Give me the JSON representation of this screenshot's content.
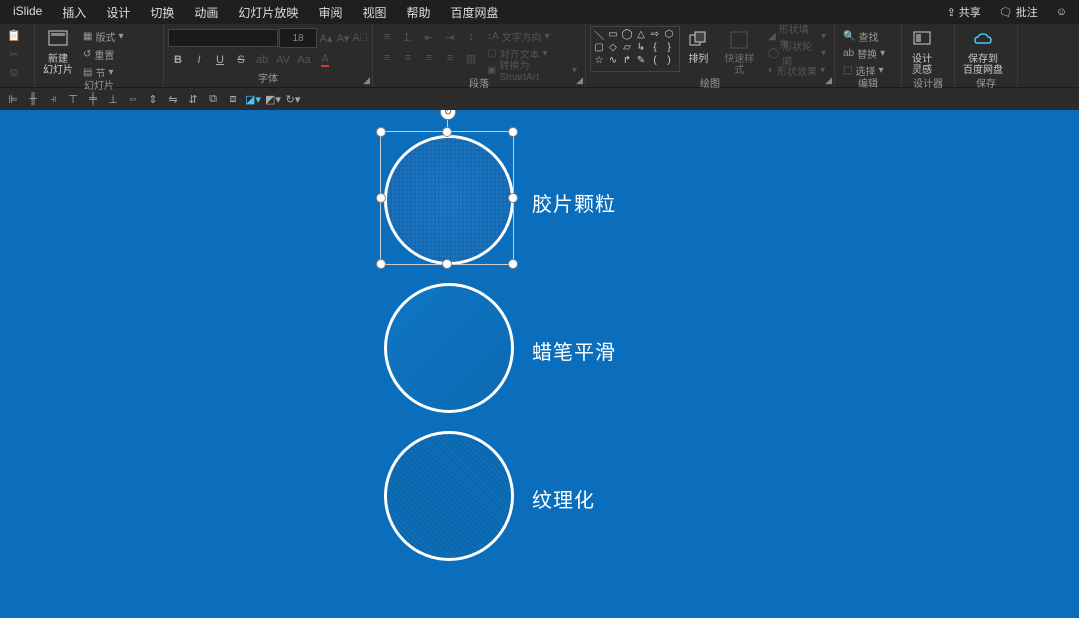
{
  "menu": {
    "tabs": [
      "iSlide",
      "插入",
      "设计",
      "切换",
      "动画",
      "幻灯片放映",
      "审阅",
      "视图",
      "帮助",
      "百度网盘"
    ],
    "share": "共享",
    "comment": "批注"
  },
  "ribbon": {
    "slide": {
      "new_slide": "新建\n幻灯片",
      "layout": "版式",
      "reset": "重置",
      "section": "节",
      "group": "幻灯片"
    },
    "font": {
      "size": "18",
      "bold": "B",
      "italic": "I",
      "underline": "U",
      "strike": "S",
      "highlight": "ab",
      "spacing": "AV",
      "clear": "A",
      "increase": "A",
      "decrease": "A",
      "group": "字体",
      "ax": "A",
      "aa": "Aa"
    },
    "para": {
      "convert_smartart": "转换为 SmartArt",
      "text_direction": "文字方向",
      "align_text": "对齐文本",
      "group": "段落"
    },
    "draw": {
      "arrange": "排列",
      "quick_style": "快速样式",
      "shape_fill": "形状填充",
      "shape_outline": "形状轮廓",
      "shape_effects": "形状效果",
      "group": "绘图"
    },
    "edit": {
      "find": "查找",
      "replace": "替换",
      "select": "选择",
      "group": "编辑"
    },
    "designer": {
      "design_ideas": "设计\n灵感",
      "group": "设计器"
    },
    "save": {
      "save_baidu": "保存到\n百度网盘",
      "group": "保存"
    }
  },
  "shapes": {
    "label1": "胶片颗粒",
    "label2": "蜡笔平滑",
    "label3": "纹理化"
  }
}
